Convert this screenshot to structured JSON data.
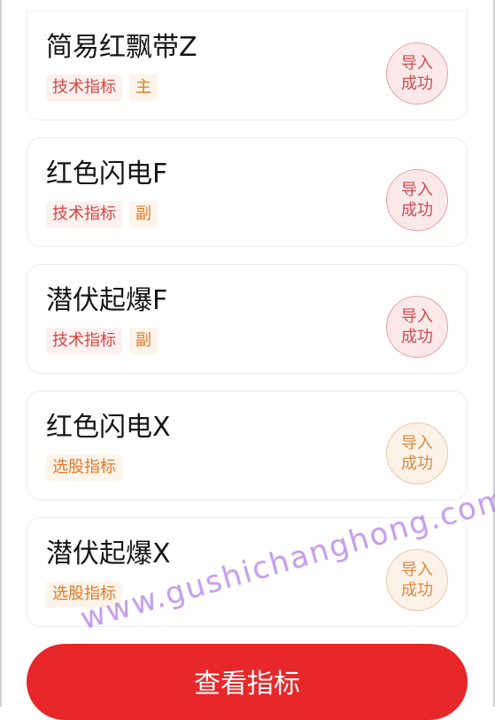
{
  "cards": [
    {
      "title": "简易红飘带Z",
      "tags": [
        {
          "text": "技术指标",
          "color": "red"
        },
        {
          "text": "主",
          "color": "orange"
        }
      ],
      "status": "导入成功",
      "status_color": "red"
    },
    {
      "title": "红色闪电F",
      "tags": [
        {
          "text": "技术指标",
          "color": "red"
        },
        {
          "text": "副",
          "color": "orange"
        }
      ],
      "status": "导入成功",
      "status_color": "red"
    },
    {
      "title": "潜伏起爆F",
      "tags": [
        {
          "text": "技术指标",
          "color": "red"
        },
        {
          "text": "副",
          "color": "orange"
        }
      ],
      "status": "导入成功",
      "status_color": "red"
    },
    {
      "title": "红色闪电X",
      "tags": [
        {
          "text": "选股指标",
          "color": "orange"
        }
      ],
      "status": "导入成功",
      "status_color": "orange"
    },
    {
      "title": "潜伏起爆X",
      "tags": [
        {
          "text": "选股指标",
          "color": "orange"
        }
      ],
      "status": "导入成功",
      "status_color": "orange"
    }
  ],
  "button": {
    "label": "查看指标"
  },
  "watermark": "www.gushichanghong.com",
  "colors": {
    "button": "#e8272a",
    "tag_red": "#d7453f",
    "tag_orange": "#e07a2c",
    "stamp_red": "#cf4a4e",
    "stamp_orange": "#d98a44"
  }
}
